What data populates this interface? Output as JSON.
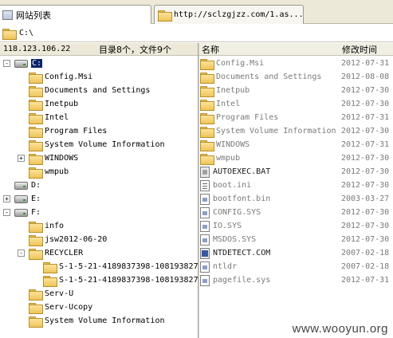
{
  "tabs": [
    {
      "label": "网站列表"
    },
    {
      "label": "http://sclzgjzz.com/1.as..."
    }
  ],
  "address": {
    "path": "C:\\"
  },
  "left_header": {
    "ip": "118.123.106.22",
    "summary": "目录8个，文件9个"
  },
  "right_header": {
    "col_name": "名称",
    "col_modified": "修改时间"
  },
  "tree": {
    "drive_c": {
      "label": "C:",
      "expander": "-"
    },
    "c_children": [
      "Config.Msi",
      "Documents and Settings",
      "Inetpub",
      "Intel",
      "Program Files",
      "System Volume Information",
      "WINDOWS",
      "wmpub"
    ],
    "windows_expander": "+",
    "drive_d": {
      "label": "D:"
    },
    "drive_e": {
      "label": "E:",
      "expander": "+"
    },
    "drive_f": {
      "label": "F:",
      "expander": "-"
    },
    "f_children": [
      "info",
      "jsw2012-06-20",
      "RECYCLER"
    ],
    "recycler_expander": "-",
    "recycler_children": [
      "S-1-5-21-4189837398-108193827",
      "S-1-5-21-4189837398-108193827"
    ],
    "f_children_after": [
      "Serv-U",
      "Serv-Ucopy",
      "System Volume Information"
    ]
  },
  "files": [
    {
      "name": "Config.Msi",
      "date": "2012-07-31",
      "icon": "folder-icon"
    },
    {
      "name": "Documents and Settings",
      "date": "2012-08-08",
      "icon": "folder-icon"
    },
    {
      "name": "Inetpub",
      "date": "2012-07-30",
      "icon": "folder-icon"
    },
    {
      "name": "Intel",
      "date": "2012-07-30",
      "icon": "folder-icon"
    },
    {
      "name": "Program Files",
      "date": "2012-07-31",
      "icon": "folder-icon"
    },
    {
      "name": "System Volume Information",
      "date": "2012-07-30",
      "icon": "folder-icon"
    },
    {
      "name": "WINDOWS",
      "date": "2012-07-31",
      "icon": "folder-icon"
    },
    {
      "name": "wmpub",
      "date": "2012-07-30",
      "icon": "folder-icon"
    },
    {
      "name": "AUTOEXEC.BAT",
      "date": "2012-07-30",
      "icon": "bat-file-icon"
    },
    {
      "name": "boot.ini",
      "date": "2012-07-30",
      "icon": "ini-file-icon"
    },
    {
      "name": "bootfont.bin",
      "date": "2003-03-27",
      "icon": "sys-file-icon"
    },
    {
      "name": "CONFIG.SYS",
      "date": "2012-07-30",
      "icon": "sys-file-icon"
    },
    {
      "name": "IO.SYS",
      "date": "2012-07-30",
      "icon": "sys-file-icon"
    },
    {
      "name": "MSDOS.SYS",
      "date": "2012-07-30",
      "icon": "sys-file-icon"
    },
    {
      "name": "NTDETECT.COM",
      "date": "2007-02-18",
      "icon": "com-file-icon"
    },
    {
      "name": "ntldr",
      "date": "2007-02-18",
      "icon": "sys-file-icon"
    },
    {
      "name": "pagefile.sys",
      "date": "2012-07-31",
      "icon": "sys-file-icon"
    }
  ],
  "watermark": "www.wooyun.org"
}
